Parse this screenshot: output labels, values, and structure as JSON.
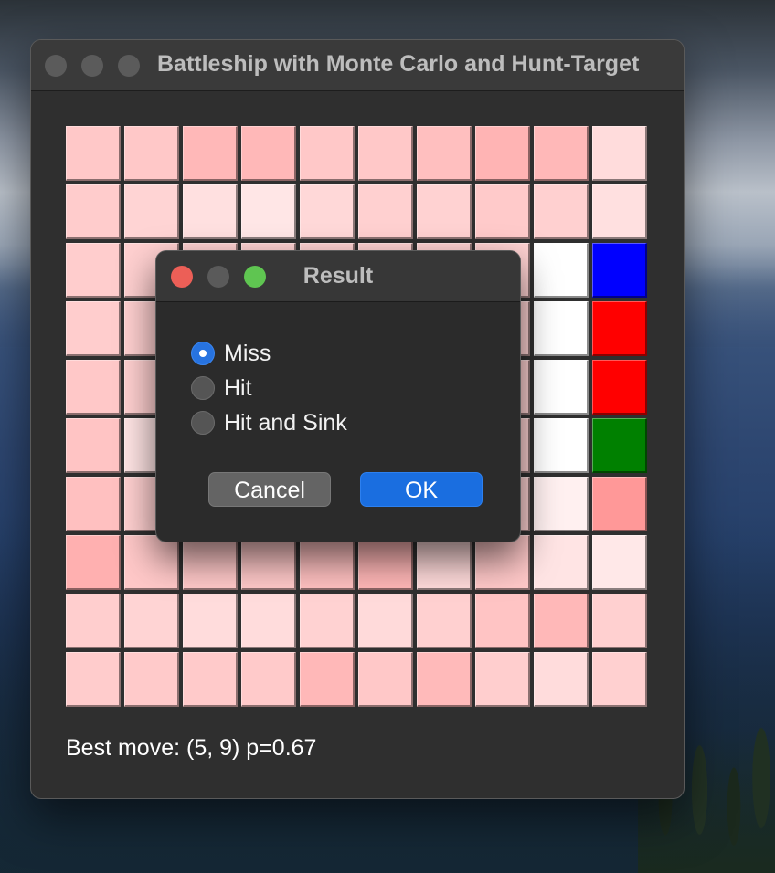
{
  "window": {
    "title": "Battleship with Monte Carlo and Hunt-Target"
  },
  "status": {
    "best_move": "Best move: (5, 9) p=0.67"
  },
  "dialog": {
    "title": "Result",
    "options": [
      "Miss",
      "Hit",
      "Hit and Sink"
    ],
    "selected": "Miss",
    "cancel_label": "Cancel",
    "ok_label": "OK"
  },
  "colors": {
    "ok_button": "#1a6ee0",
    "ship_blue": "#0000ff",
    "hit_red": "#ff0000",
    "sunk_green": "#008000"
  },
  "board": {
    "rows": [
      [
        "#ffc8c8",
        "#ffc8c8",
        "#ffb8b8",
        "#ffb8b8",
        "#ffc8c8",
        "#ffc8c8",
        "#ffbfbf",
        "#ffb4b4",
        "#ffb8b8",
        "#ffdcdc"
      ],
      [
        "#ffcccc",
        "#ffd4d4",
        "#ffe0e0",
        "#ffe6e6",
        "#ffd8d8",
        "#ffd0d0",
        "#ffd2d2",
        "#ffcaca",
        "#ffd0d0",
        "#ffe0e0"
      ],
      [
        "#ffcdcd",
        "#ffd0d0",
        "#ffd2d2",
        "#ffd2d2",
        "#ffd2d2",
        "#ffd2d2",
        "#ffd2d2",
        "#ffd2d2",
        "#ffffff",
        "#0000ff"
      ],
      [
        "#ffcdcd",
        "#ffd0d0",
        "#ffd2d2",
        "#ffd2d2",
        "#ffd2d2",
        "#ffd2d2",
        "#ffd2d2",
        "#ffd2d2",
        "#ffffff",
        "#ff0000"
      ],
      [
        "#ffc8c8",
        "#ffd0d0",
        "#ffd2d2",
        "#ffd2d2",
        "#ffd2d2",
        "#ffd2d2",
        "#ffd2d2",
        "#ffd2d2",
        "#ffffff",
        "#ff0000"
      ],
      [
        "#ffc4c4",
        "#ffe4e4",
        "#ffd2d2",
        "#ffd2d2",
        "#ffd2d2",
        "#ffd2d2",
        "#ffd2d2",
        "#ffd2d2",
        "#ffffff",
        "#008000"
      ],
      [
        "#ffc0c0",
        "#ffd0d0",
        "#ffd2d2",
        "#ffd2d2",
        "#ffd2d2",
        "#ffd2d2",
        "#ffd2d2",
        "#ffd2d2",
        "#fff0f0",
        "#ff9898"
      ],
      [
        "#ffb0b0",
        "#ffc8c8",
        "#ffc8c8",
        "#ffc8c8",
        "#ffc0c0",
        "#ffb6b6",
        "#ffdada",
        "#ffc8c8",
        "#ffe4e4",
        "#ffe8e8"
      ],
      [
        "#ffcece",
        "#ffd4d4",
        "#ffdcdc",
        "#ffdcdc",
        "#ffd2d2",
        "#ffdada",
        "#ffd0d0",
        "#ffc4c4",
        "#ffb8b8",
        "#ffd0d0"
      ],
      [
        "#ffcccc",
        "#ffcaca",
        "#ffcaca",
        "#ffcaca",
        "#ffb8b8",
        "#ffc8c8",
        "#ffbaba",
        "#ffcece",
        "#ffdcdc",
        "#ffd0d0"
      ]
    ]
  }
}
